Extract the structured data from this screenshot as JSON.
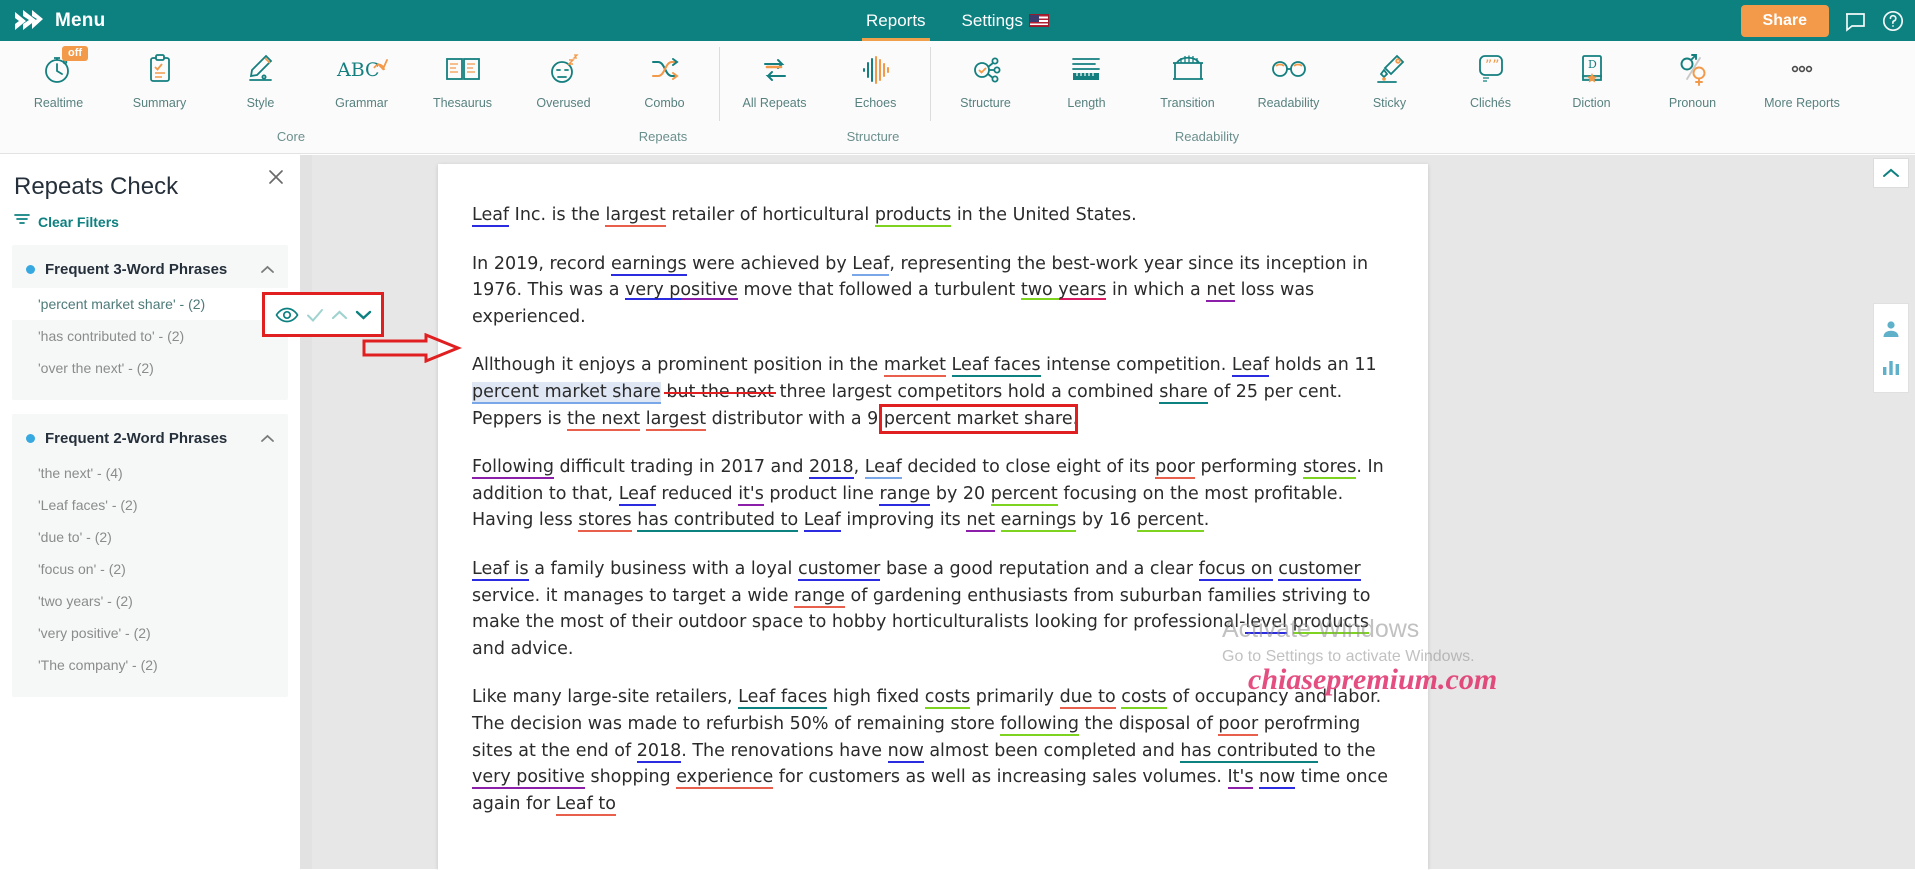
{
  "topbar": {
    "menu_label": "Menu",
    "logo_icon": "prowritingaid-logo-icon",
    "nav": [
      {
        "label": "Reports",
        "active": true
      },
      {
        "label": "Settings",
        "active": false,
        "flag": "us-flag-icon"
      }
    ],
    "share_label": "Share",
    "chat_icon": "chat-bubble-icon",
    "help_icon": "help-circle-icon"
  },
  "ribbon": {
    "tools": [
      {
        "label": "Realtime",
        "icon": "stopwatch-icon",
        "badge": "off"
      },
      {
        "label": "Summary",
        "icon": "clipboard-check-icon"
      },
      {
        "label": "Style",
        "icon": "pencil-icon"
      },
      {
        "label": "Grammar",
        "icon": "abc-check-icon"
      },
      {
        "label": "Thesaurus",
        "icon": "open-book-icon"
      },
      {
        "label": "Overused",
        "icon": "sleepy-face-icon"
      },
      {
        "label": "Combo",
        "icon": "shuffle-arrows-icon"
      },
      {
        "label": "All Repeats",
        "icon": "repeat-arrows-icon"
      },
      {
        "label": "Echoes",
        "icon": "waveform-icon"
      },
      {
        "label": "Structure",
        "icon": "node-graph-icon"
      },
      {
        "label": "Length",
        "icon": "ruler-lines-icon"
      },
      {
        "label": "Transition",
        "icon": "bridge-icon"
      },
      {
        "label": "Readability",
        "icon": "glasses-icon"
      },
      {
        "label": "Sticky",
        "icon": "glue-tag-icon"
      },
      {
        "label": "Clichés",
        "icon": "quote-bubble-icon"
      },
      {
        "label": "Diction",
        "icon": "dictionary-book-icon"
      },
      {
        "label": "Pronoun",
        "icon": "gender-symbols-icon"
      },
      {
        "label": "More Reports",
        "icon": "ellipsis-icon"
      }
    ],
    "groups": [
      {
        "label": "Core"
      },
      {
        "label": "Repeats"
      },
      {
        "label": "Structure"
      },
      {
        "label": "Readability"
      }
    ]
  },
  "panel": {
    "title": "Repeats Check",
    "clear_filters_label": "Clear Filters",
    "filter_icon": "filter-icon",
    "close_icon": "close-icon",
    "groups": [
      {
        "title": "Frequent 3-Word Phrases",
        "collapse_icon": "chevron-up-icon",
        "items": [
          {
            "label": "'percent market share' - (2)",
            "selected": true
          },
          {
            "label": "'has contributed to' - (2)",
            "selected": false
          },
          {
            "label": "'over the next' - (2)",
            "selected": false
          }
        ]
      },
      {
        "title": "Frequent 2-Word Phrases",
        "collapse_icon": "chevron-up-icon",
        "items": [
          {
            "label": "'the next' - (4)",
            "selected": false
          },
          {
            "label": "'Leaf faces' - (2)",
            "selected": false
          },
          {
            "label": "'due to' - (2)",
            "selected": false
          },
          {
            "label": "'focus on' - (2)",
            "selected": false
          },
          {
            "label": "'two years' - (2)",
            "selected": false
          },
          {
            "label": "'very positive' - (2)",
            "selected": false
          },
          {
            "label": "'The company' - (2)",
            "selected": false
          }
        ]
      }
    ],
    "row_controls": {
      "eye_icon": "eye-icon",
      "check_icon": "check-icon",
      "prev_icon": "chevron-up-icon",
      "next_icon": "chevron-down-icon"
    }
  },
  "annotations": {
    "control_box_color": "#e02020",
    "arrow_color": "#e02020",
    "phrase_box_color": "#e02020"
  },
  "document": {
    "paragraphs": [
      "Leaf Inc. is the largest retailer of horticultural products in the United States.",
      "In 2019, record earnings were achieved by Leaf, representing the best-work year since its inception in 1976. This was a very positive move that followed a turbulent two years in which a net loss was experienced.",
      "Allthough it enjoys a prominent position in the market Leaf faces intense competition. Leaf holds an 11 percent market share but the next three largest competitors hold a combined share of 25 per cent. Peppers is the next largest distributor with a 9 percent market share.",
      "Following difficult trading in 2017 and 2018, Leaf decided to close eight of its poor performing stores. In addition to that, Leaf reduced it's product line range by 20 percent focusing on the most profitable. Having less stores has contributed to Leaf improving its net earnings by 16 percent.",
      "Leaf is a family business with a loyal customer base a good reputation and a clear focus on customer service. it manages to target a wide range of gardening enthusiasts from suburban families striving to make the most of their outdoor space to hobby horticulturalists looking for professional-level products and advice.",
      "Like many large-site retailers, Leaf faces high fixed costs primarily due to costs of occupancy and labor. The decision was made to refurbish 50% of remaining store following the disposal of poor perofrming sites at the end of 2018. The renovations have now almost been completed and has contributed to the very positive shopping experience for customers as well as increasing sales volumes. It's now time once again for Leaf to"
    ]
  },
  "right_rail": {
    "scroll_top_icon": "chevron-up-icon",
    "account_icon": "person-icon",
    "stats_icon": "bar-chart-icon"
  },
  "watermarks": {
    "activate_line1": "Activate Windows",
    "activate_line2": "Go to Settings to activate Windows.",
    "site": "chiasepremium.com"
  },
  "colors": {
    "brand_teal": "#0d8080",
    "accent_orange": "#f2994a",
    "annotation_red": "#e02020",
    "highlight_blue": "#dfe7f5",
    "dot_blue": "#37a8e0"
  }
}
